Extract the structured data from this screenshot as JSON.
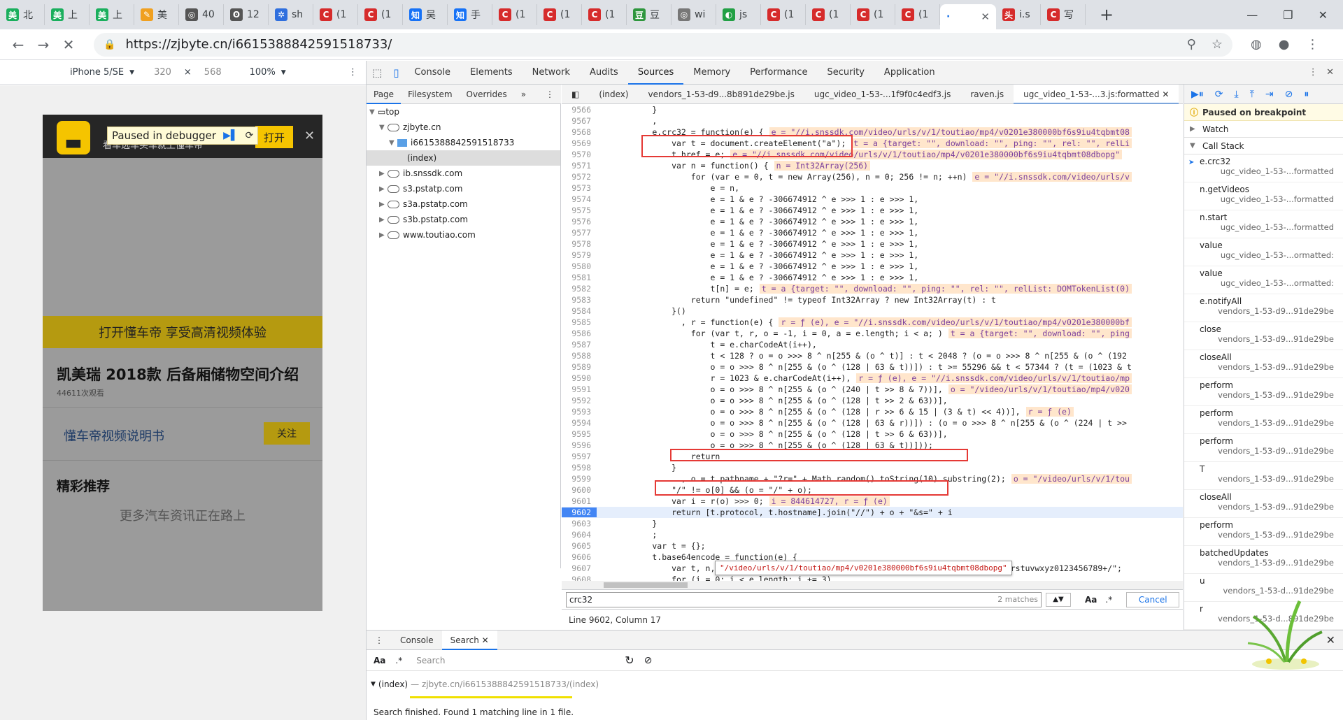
{
  "browser": {
    "tabs": [
      {
        "icon_text": "美",
        "icon_color": "#1aaf5d",
        "label": "北"
      },
      {
        "icon_text": "美",
        "icon_color": "#1aaf5d",
        "label": "上"
      },
      {
        "icon_text": "美",
        "icon_color": "#1aaf5d",
        "label": "上"
      },
      {
        "icon_text": "✎",
        "icon_color": "#f0a020",
        "label": "美"
      },
      {
        "icon_text": "◎",
        "icon_color": "#555555",
        "label": "40"
      },
      {
        "icon_text": "ʘ",
        "icon_color": "#555555",
        "label": "12"
      },
      {
        "icon_text": "✲",
        "icon_color": "#2f6fde",
        "label": "sh"
      },
      {
        "icon_text": "C",
        "icon_color": "#d62b2b",
        "label": "(1"
      },
      {
        "icon_text": "C",
        "icon_color": "#d62b2b",
        "label": "(1"
      },
      {
        "icon_text": "知",
        "icon_color": "#1772f6",
        "label": "吴"
      },
      {
        "icon_text": "知",
        "icon_color": "#1772f6",
        "label": "手"
      },
      {
        "icon_text": "C",
        "icon_color": "#d62b2b",
        "label": "(1"
      },
      {
        "icon_text": "C",
        "icon_color": "#d62b2b",
        "label": "(1"
      },
      {
        "icon_text": "C",
        "icon_color": "#d62b2b",
        "label": "(1"
      },
      {
        "icon_text": "豆",
        "icon_color": "#2e963d",
        "label": "豆"
      },
      {
        "icon_text": "◎",
        "icon_color": "#777777",
        "label": "wi"
      },
      {
        "icon_text": "◐",
        "icon_color": "#22a045",
        "label": "js"
      },
      {
        "icon_text": "C",
        "icon_color": "#d62b2b",
        "label": "(1"
      },
      {
        "icon_text": "C",
        "icon_color": "#d62b2b",
        "label": "(1"
      },
      {
        "icon_text": "C",
        "icon_color": "#d62b2b",
        "label": "(1"
      },
      {
        "icon_text": "C",
        "icon_color": "#d62b2b",
        "label": "(1"
      }
    ],
    "active_tab": {
      "label": "·",
      "close": "✕"
    },
    "after_tabs": [
      {
        "icon_text": "头",
        "icon_color": "#d62b2b",
        "label": "i.s"
      },
      {
        "icon_text": "C",
        "icon_color": "#d62b2b",
        "label": "写"
      }
    ],
    "new_tab": "+",
    "window_controls": {
      "minimize": "—",
      "restore": "❐",
      "close": "✕"
    },
    "nav": {
      "back": "←",
      "forward": "→",
      "stop": "✕"
    },
    "url": "https://zjbyte.cn/i6615388842591518733/",
    "lock": "🔒",
    "omnibox_icons": {
      "zoom": "⚲",
      "star": "☆"
    },
    "toolbar_icons": {
      "ext": "◍",
      "profile": "●",
      "menu": "⋮"
    }
  },
  "device_toolbar": {
    "device": "iPhone 5/SE",
    "width": "320",
    "times": "×",
    "height": "568",
    "zoom": "100%",
    "more": "⋮"
  },
  "mobile_page": {
    "app_desc": "看车选车买车就上懂车帝",
    "open_button": "打开",
    "close": "✕",
    "paused_label": "Paused in debugger",
    "banner_text": "打开懂车帝 享受高清视频体验",
    "video_title": "凯美瑞 2018款 后备厢储物空间介绍",
    "views": "44611次观看",
    "channel_title": "懂车帝视频说明书",
    "follow_label": "关注",
    "rec_title": "精彩推荐",
    "rec_more": "更多汽车资讯正在路上"
  },
  "devtools": {
    "main_tabs": [
      "Console",
      "Elements",
      "Network",
      "Audits",
      "Sources",
      "Memory",
      "Performance",
      "Security",
      "Application"
    ],
    "active_main": "Sources",
    "nav_tabs": [
      "Page",
      "Filesystem",
      "Overrides",
      "»"
    ],
    "tree": [
      {
        "label": "top",
        "depth": 0,
        "kind": "frame",
        "arrow": "▼"
      },
      {
        "label": "zjbyte.cn",
        "depth": 1,
        "kind": "cloud",
        "arrow": "▼"
      },
      {
        "label": "i6615388842591518733",
        "depth": 2,
        "kind": "folder",
        "arrow": "▼"
      },
      {
        "label": "(index)",
        "depth": 3,
        "kind": "file",
        "arrow": ""
      },
      {
        "label": "ib.snssdk.com",
        "depth": 1,
        "kind": "cloud",
        "arrow": "▶"
      },
      {
        "label": "s3.pstatp.com",
        "depth": 1,
        "kind": "cloud",
        "arrow": "▶"
      },
      {
        "label": "s3a.pstatp.com",
        "depth": 1,
        "kind": "cloud",
        "arrow": "▶"
      },
      {
        "label": "s3b.pstatp.com",
        "depth": 1,
        "kind": "cloud",
        "arrow": "▶"
      },
      {
        "label": "www.toutiao.com",
        "depth": 1,
        "kind": "cloud",
        "arrow": "▶"
      }
    ],
    "file_tabs": [
      "(index)",
      "vendors_1-53-d9...8b891de29be.js",
      "ugc_video_1-53-...1f9f0c4edf3.js",
      "raven.js",
      "ugc_video_1-53-...3.js:formatted ✕"
    ],
    "code_lines": [
      {
        "n": "9566",
        "code": "        }"
      },
      {
        "n": "9567",
        "code": "        ,"
      },
      {
        "n": "9568",
        "code": "        e.crc32 = function(e) {",
        "hint": "e = \"//i.snssdk.com/video/urls/v/1/toutiao/mp4/v0201e380000bf6s9iu4tqbmt08"
      },
      {
        "n": "9569",
        "code": "            var t = document.createElement(\"a\");",
        "hint": "t = a {target: \"\", download: \"\", ping: \"\", rel: \"\", relLi"
      },
      {
        "n": "9570",
        "code": "            t.href = e;",
        "hint": "e = \"//i.snssdk.com/video/urls/v/1/toutiao/mp4/v0201e380000bf6s9iu4tqbmt08dbopg\""
      },
      {
        "n": "9571",
        "code": "            var n = function() {",
        "hint": "n = Int32Array(256)"
      },
      {
        "n": "9572",
        "code": "                for (var e = 0, t = new Array(256), n = 0; 256 != n; ++n)",
        "hint": "e = \"//i.snssdk.com/video/urls/v"
      },
      {
        "n": "9573",
        "code": "                    e = n,"
      },
      {
        "n": "9574",
        "code": "                    e = 1 & e ? -306674912 ^ e >>> 1 : e >>> 1,"
      },
      {
        "n": "9575",
        "code": "                    e = 1 & e ? -306674912 ^ e >>> 1 : e >>> 1,"
      },
      {
        "n": "9576",
        "code": "                    e = 1 & e ? -306674912 ^ e >>> 1 : e >>> 1,"
      },
      {
        "n": "9577",
        "code": "                    e = 1 & e ? -306674912 ^ e >>> 1 : e >>> 1,"
      },
      {
        "n": "9578",
        "code": "                    e = 1 & e ? -306674912 ^ e >>> 1 : e >>> 1,"
      },
      {
        "n": "9579",
        "code": "                    e = 1 & e ? -306674912 ^ e >>> 1 : e >>> 1,"
      },
      {
        "n": "9580",
        "code": "                    e = 1 & e ? -306674912 ^ e >>> 1 : e >>> 1,"
      },
      {
        "n": "9581",
        "code": "                    e = 1 & e ? -306674912 ^ e >>> 1 : e >>> 1,"
      },
      {
        "n": "9582",
        "code": "                    t[n] = e;",
        "hint": "t = a {target: \"\", download: \"\", ping: \"\", rel: \"\", relList: DOMTokenList(0)"
      },
      {
        "n": "9583",
        "code": "                return \"undefined\" != typeof Int32Array ? new Int32Array(t) : t"
      },
      {
        "n": "9584",
        "code": "            }()"
      },
      {
        "n": "9585",
        "code": "              , r = function(e) {",
        "hint": "r = ƒ (e), e = \"//i.snssdk.com/video/urls/v/1/toutiao/mp4/v0201e380000bf"
      },
      {
        "n": "9586",
        "code": "                for (var t, r, o = -1, i = 0, a = e.length; i < a; )",
        "hint": "t = a {target: \"\", download: \"\", ping"
      },
      {
        "n": "9587",
        "code": "                    t = e.charCodeAt(i++),"
      },
      {
        "n": "9588",
        "code": "                    t < 128 ? o = o >>> 8 ^ n[255 & (o ^ t)] : t < 2048 ? (o = o >>> 8 ^ n[255 & (o ^ (192"
      },
      {
        "n": "9589",
        "code": "                    o = o >>> 8 ^ n[255 & (o ^ (128 | 63 & t))]) : t >= 55296 && t < 57344 ? (t = (1023 & t"
      },
      {
        "n": "9590",
        "code": "                    r = 1023 & e.charCodeAt(i++),",
        "hint": "r = ƒ (e), e = \"//i.snssdk.com/video/urls/v/1/toutiao/mp"
      },
      {
        "n": "9591",
        "code": "                    o = o >>> 8 ^ n[255 & (o ^ (240 | t >> 8 & 7))],",
        "hint": "o = \"/video/urls/v/1/toutiao/mp4/v020"
      },
      {
        "n": "9592",
        "code": "                    o = o >>> 8 ^ n[255 & (o ^ (128 | t >> 2 & 63))],"
      },
      {
        "n": "9593",
        "code": "                    o = o >>> 8 ^ n[255 & (o ^ (128 | r >> 6 & 15 | (3 & t) << 4))],",
        "hint": "r = ƒ (e)"
      },
      {
        "n": "9594",
        "code": "                    o = o >>> 8 ^ n[255 & (o ^ (128 | 63 & r))]) : (o = o >>> 8 ^ n[255 & (o ^ (224 | t >>"
      },
      {
        "n": "9595",
        "code": "                    o = o >>> 8 ^ n[255 & (o ^ (128 | t >> 6 & 63))],"
      },
      {
        "n": "9596",
        "code": "                    o = o >>> 8 ^ n[255 & (o ^ (128 | 63 & t))]));"
      },
      {
        "n": "9597",
        "code": "                return"
      },
      {
        "n": "9598",
        "code": "            }"
      },
      {
        "n": "9599",
        "code": "              , o = t.pathname + \"?r=\" + Math.random().toString(10).substring(2);",
        "hint": "o = \"/video/urls/v/1/tou"
      },
      {
        "n": "9600",
        "code": "            \"/\" != o[0] && (o = \"/\" + o);"
      },
      {
        "n": "9601",
        "code": "            var i = r(o) >>> 0;",
        "hint": "i = 844614727, r = ƒ (e)"
      },
      {
        "n": "9602",
        "code": "            return [t.protocol, t.hostname].join(\"//\") + o + \"&s=\" + i",
        "exec": true
      },
      {
        "n": "9603",
        "code": "        }"
      },
      {
        "n": "9604",
        "code": "        ;"
      },
      {
        "n": "9605",
        "code": "        var t = {};"
      },
      {
        "n": "9606",
        "code": "        t.base64encode = function(e) {"
      },
      {
        "n": "9607",
        "code": "            var t, n, r, o, i, a, s = \"ABCDEFGHIJKLMNOPQRSTUVWXYZabcdefghijklmnopqrstuvwxyz0123456789+/\";"
      },
      {
        "n": "9608",
        "code": "            for (i = 0; i < e.length; i += 3)"
      }
    ],
    "tooltip": "\"/video/urls/v/1/toutiao/mp4/v0201e380000bf6s9iu4tqbmt08dbopg\"",
    "search": {
      "query": "crc32",
      "matches": "2 matches",
      "aa": "Aa",
      "regex": ".*",
      "cancel": "Cancel",
      "up": "▲",
      "down": "▼"
    },
    "status": "Line 9602, Column 17",
    "right_toolbar": [
      "▶⏸",
      "⟳",
      "⤓",
      "⤒",
      "⇥",
      "⊘",
      "⏸"
    ],
    "paused": "Paused on breakpoint",
    "watch": "Watch",
    "callstack": "Call Stack",
    "frames": [
      {
        "fn": "e.crc32",
        "loc": "ugc_video_1-53-...formatted",
        "current": true
      },
      {
        "fn": "n.getVideos",
        "loc": "ugc_video_1-53-...formatted"
      },
      {
        "fn": "n.start",
        "loc": "ugc_video_1-53-...formatted"
      },
      {
        "fn": "value",
        "loc": "ugc_video_1-53-...ormatted:"
      },
      {
        "fn": "value",
        "loc": "ugc_video_1-53-...ormatted:"
      },
      {
        "fn": "e.notifyAll",
        "loc": "vendors_1-53-d9...91de29be"
      },
      {
        "fn": "close",
        "loc": "vendors_1-53-d9...91de29be"
      },
      {
        "fn": "closeAll",
        "loc": "vendors_1-53-d9...91de29be"
      },
      {
        "fn": "perform",
        "loc": "vendors_1-53-d9...91de29be"
      },
      {
        "fn": "perform",
        "loc": "vendors_1-53-d9...91de29be"
      },
      {
        "fn": "perform",
        "loc": "vendors_1-53-d9...91de29be"
      },
      {
        "fn": "T",
        "loc": "vendors_1-53-d9...91de29be"
      },
      {
        "fn": "closeAll",
        "loc": "vendors_1-53-d9...91de29be"
      },
      {
        "fn": "perform",
        "loc": "vendors_1-53-d9...91de29be"
      },
      {
        "fn": "batchedUpdates",
        "loc": "vendors_1-53-d9...91de29be"
      },
      {
        "fn": "u",
        "loc": "vendors_1-53-d...91de29be"
      },
      {
        "fn": "r",
        "loc": "vendors_1-53-d...891de29be"
      }
    ],
    "drawer": {
      "tabs": [
        "Console",
        "Search ✕"
      ],
      "close": "✕",
      "aa": "Aa",
      "regex": ".*",
      "placeholder": "Search",
      "refresh": "↻",
      "clear": "⊘",
      "result_file": "(index)",
      "result_path": "— zjbyte.cn/i6615388842591518733/(index)",
      "finish": "Search finished.  Found 1 matching line in 1 file."
    }
  }
}
